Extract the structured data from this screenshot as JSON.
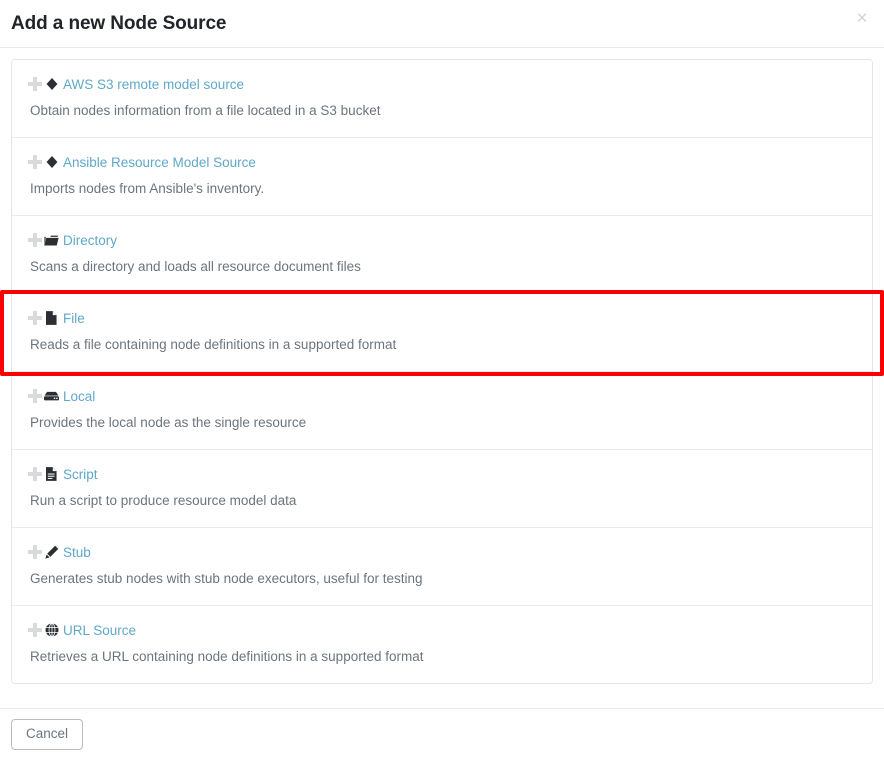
{
  "header": {
    "title": "Add a new Node Source",
    "close_label": "×"
  },
  "sources": [
    {
      "icon": "gem-icon",
      "title": "AWS S3 remote model source",
      "description": "Obtain nodes information from a file located in a S3 bucket",
      "highlighted": false
    },
    {
      "icon": "gem-icon",
      "title": "Ansible Resource Model Source",
      "description": "Imports nodes from Ansible's inventory.",
      "highlighted": false
    },
    {
      "icon": "folder-icon",
      "title": "Directory",
      "description": "Scans a directory and loads all resource document files",
      "highlighted": false
    },
    {
      "icon": "file-icon",
      "title": "File",
      "description": "Reads a file containing node definitions in a supported format",
      "highlighted": true
    },
    {
      "icon": "server-icon",
      "title": "Local",
      "description": "Provides the local node as the single resource",
      "highlighted": false
    },
    {
      "icon": "file-lines-icon",
      "title": "Script",
      "description": "Run a script to produce resource model data",
      "highlighted": false
    },
    {
      "icon": "pencil-icon",
      "title": "Stub",
      "description": "Generates stub nodes with stub node executors, useful for testing",
      "highlighted": false
    },
    {
      "icon": "globe-icon",
      "title": "URL Source",
      "description": "Retrieves a URL containing node definitions in a supported format",
      "highlighted": false
    }
  ],
  "footer": {
    "cancel_label": "Cancel"
  },
  "colors": {
    "link": "#5fa8c9",
    "description": "#6c757d",
    "title": "#212529",
    "highlight": "#fa0000",
    "border": "#e9ecef"
  }
}
